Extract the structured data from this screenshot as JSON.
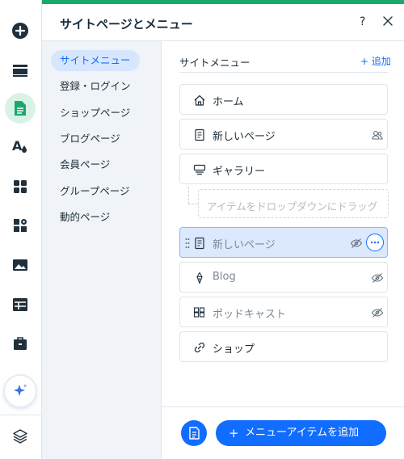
{
  "panel": {
    "title": "サイトページとメニュー",
    "help": "?",
    "accent_color": "#116dff",
    "top_bar_color": "#1aa86b"
  },
  "rail": {
    "tools": [
      {
        "icon": "add-icon"
      },
      {
        "icon": "sections-icon"
      },
      {
        "icon": "pages-icon",
        "active": true
      },
      {
        "icon": "design-icon"
      },
      {
        "icon": "apps-icon"
      },
      {
        "icon": "business-tools-icon"
      },
      {
        "icon": "media-icon"
      },
      {
        "icon": "cms-icon"
      },
      {
        "icon": "portfolio-icon"
      },
      {
        "icon": "ai-sparkle-icon"
      },
      {
        "icon": "layers-icon"
      }
    ]
  },
  "nav": {
    "items": [
      {
        "label": "サイトメニュー"
      },
      {
        "label": "登録・ログイン"
      },
      {
        "label": "ショップページ"
      },
      {
        "label": "ブログページ"
      },
      {
        "label": "会員ページ"
      },
      {
        "label": "グループページ"
      },
      {
        "label": "動的ページ"
      }
    ]
  },
  "content": {
    "section_title": "サイトメニュー",
    "add_link": "+ 追加",
    "drop_hint": "アイテムをドロップダウンにドラッグ",
    "items": [
      {
        "label": "ホーム",
        "icon": "home-icon"
      },
      {
        "label": "新しいページ",
        "icon": "page-icon",
        "right_icon": "members-icon"
      },
      {
        "label": "ギャラリー",
        "icon": "gallery-icon"
      },
      {
        "label": "新しいページ",
        "icon": "page-icon",
        "right_icon": "hidden-eye-icon",
        "state": "selected",
        "hidden": true
      },
      {
        "label": "Blog",
        "icon": "blog-icon",
        "right_icon": "hidden-eye-icon",
        "hidden": true
      },
      {
        "label": "ポッドキャスト",
        "icon": "podcast-icon",
        "right_icon": "hidden-eye-icon",
        "hidden": true
      },
      {
        "label": "ショップ",
        "icon": "link-icon"
      }
    ],
    "footer": {
      "add_item_plus": "+",
      "add_item_label": "メニューアイテムを追加"
    }
  }
}
